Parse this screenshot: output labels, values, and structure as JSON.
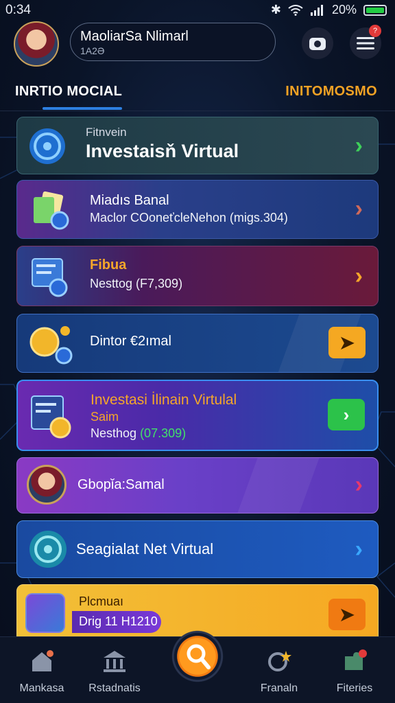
{
  "status": {
    "time": "0:34",
    "battery": "20%"
  },
  "header": {
    "user_name": "MaoliarSa Nlimarl",
    "user_id": "1А2Ә",
    "notif_badge": "?"
  },
  "tabs": {
    "left": "INRTIO MOCIAL",
    "right": "INITOMOSMO"
  },
  "cards": [
    {
      "small": "Fitnvein",
      "title": "Investaisň Virtual"
    },
    {
      "title": "Miadıs Banal",
      "sub": "Maclor COoneťcleNehon (migs.304)"
    },
    {
      "title": "Fibua",
      "sub": "Nesttog (F7,309)"
    },
    {
      "title": "Dintor €2ımal"
    },
    {
      "title": "Investasi İlinain Virtulal",
      "title2": "Saim",
      "sub": "Nesthog",
      "sub_value": "(07.309)"
    },
    {
      "title": "Gbopǐa:Samal"
    },
    {
      "title": "Seagialat Net Virtual"
    },
    {
      "title": "Plcmuaı",
      "sub": "Drig 11 H1210"
    }
  ],
  "nav": [
    {
      "label": "Mankasa"
    },
    {
      "label": "Rstadnatis"
    },
    {
      "label": "Franaln"
    },
    {
      "label": "Fiteries"
    }
  ],
  "colors": {
    "accent_blue": "#2d7fe0",
    "accent_orange": "#f2a224",
    "value_green": "#42e06a"
  }
}
